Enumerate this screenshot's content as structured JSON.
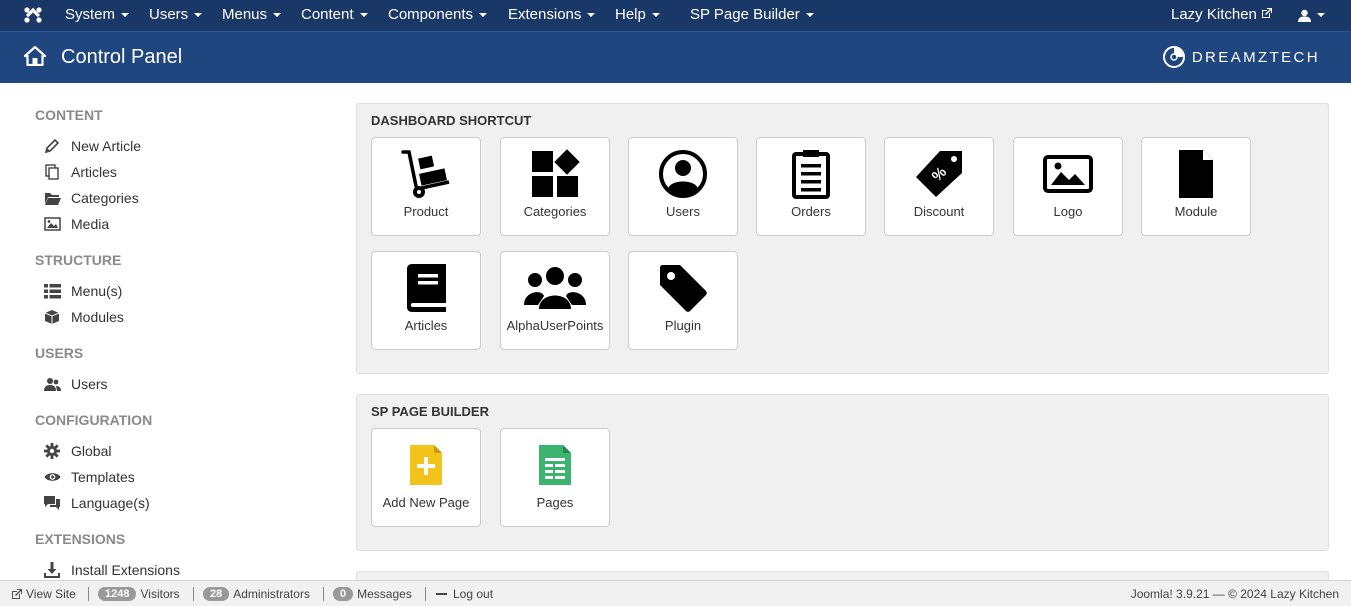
{
  "topbar": {
    "menus": [
      {
        "label": "System"
      },
      {
        "label": "Users"
      },
      {
        "label": "Menus"
      },
      {
        "label": "Content"
      },
      {
        "label": "Components"
      },
      {
        "label": "Extensions"
      },
      {
        "label": "Help"
      },
      {
        "label": "SP Page Builder"
      }
    ],
    "site_link": "Lazy Kitchen"
  },
  "header": {
    "title": "Control Panel",
    "brand": "DREAMZTECH"
  },
  "sidebar": {
    "sections": [
      {
        "heading": "CONTENT",
        "items": [
          {
            "label": "New Article",
            "icon": "pencil-icon"
          },
          {
            "label": "Articles",
            "icon": "copy-icon"
          },
          {
            "label": "Categories",
            "icon": "folder-open-icon"
          },
          {
            "label": "Media",
            "icon": "image-icon"
          }
        ]
      },
      {
        "heading": "STRUCTURE",
        "items": [
          {
            "label": "Menu(s)",
            "icon": "list-icon"
          },
          {
            "label": "Modules",
            "icon": "cube-icon"
          }
        ]
      },
      {
        "heading": "USERS",
        "items": [
          {
            "label": "Users",
            "icon": "users-icon"
          }
        ]
      },
      {
        "heading": "CONFIGURATION",
        "items": [
          {
            "label": "Global",
            "icon": "cog-icon"
          },
          {
            "label": "Templates",
            "icon": "eye-icon"
          },
          {
            "label": "Language(s)",
            "icon": "comments-icon"
          }
        ]
      },
      {
        "heading": "EXTENSIONS",
        "items": [
          {
            "label": "Install Extensions",
            "icon": "download-icon"
          }
        ]
      }
    ]
  },
  "dashboard": {
    "title": "DASHBOARD SHORTCUT",
    "tiles": [
      {
        "label": "Product",
        "icon": "hand-truck-icon"
      },
      {
        "label": "Categories",
        "icon": "categories-grid-icon"
      },
      {
        "label": "Users",
        "icon": "user-circle-icon"
      },
      {
        "label": "Orders",
        "icon": "clipboard-list-icon"
      },
      {
        "label": "Discount",
        "icon": "discount-tag-icon"
      },
      {
        "label": "Logo",
        "icon": "picture-icon"
      },
      {
        "label": "Module",
        "icon": "file-icon"
      },
      {
        "label": "Articles",
        "icon": "book-icon"
      },
      {
        "label": "AlphaUserPoints",
        "icon": "user-group-icon"
      },
      {
        "label": "Plugin",
        "icon": "tag-icon"
      }
    ]
  },
  "sppb": {
    "title": "SP PAGE BUILDER",
    "tiles": [
      {
        "label": "Add New Page",
        "icon": "add-page-icon"
      },
      {
        "label": "Pages",
        "icon": "pages-sheet-icon"
      }
    ]
  },
  "footer": {
    "view_site": "View Site",
    "visitors_count": "1248",
    "visitors_label": "Visitors",
    "admins_count": "28",
    "admins_label": "Administrators",
    "messages_count": "0",
    "messages_label": "Messages",
    "logout": "Log out",
    "version_text": "Joomla! 3.9.21 — © 2024 Lazy Kitchen"
  },
  "colors": {
    "topbar": "#1a3867",
    "header": "#1f467f",
    "add_page_yellow": "#f2c318",
    "pages_green": "#3ab46f"
  }
}
